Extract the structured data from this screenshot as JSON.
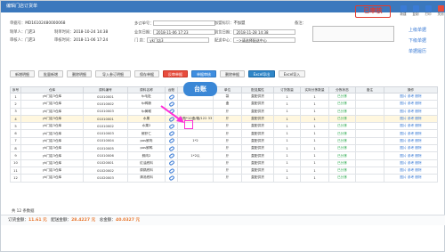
{
  "window": {
    "title": "编辑门店订货单"
  },
  "status_stamp": "已审核",
  "top_icons": [
    {
      "icon": "add-icon",
      "label": "新建",
      "color": "#3a7bd5"
    },
    {
      "icon": "copy-icon",
      "label": "复制",
      "color": "#3a7bd5"
    },
    {
      "icon": "print-icon",
      "label": "打印",
      "color": "#3a7bd5"
    },
    {
      "icon": "close-icon",
      "label": "关闭",
      "color": "#e84c3d"
    }
  ],
  "side_links": [
    "上级单据",
    "下级单据",
    "单据履历"
  ],
  "form": {
    "row1": [
      {
        "label": "单据号：",
        "value": "MD16102480000068"
      },
      {
        "label": "多订单号：",
        "value": ""
      },
      {
        "label": "加盟标识：",
        "value": "不加盟"
      },
      {
        "label": "备注：",
        "value": ""
      }
    ],
    "row2": [
      {
        "label": "制单人：",
        "value": "门店3"
      },
      {
        "label": "制单时间：",
        "value": "2018-10-24 14:38"
      },
      {
        "label": "业务日期：",
        "value": "2018-11-06 17:23"
      },
      {
        "label": "到货日期：",
        "value": "2018-11-28 14:38"
      }
    ],
    "row3": [
      {
        "label": "审核人：",
        "value": "门店3"
      },
      {
        "label": "审核时间：",
        "value": "2018-11-06 17:24"
      },
      {
        "label": "门  店：",
        "value": "yk门店3"
      },
      {
        "label": "配送中心：",
        "value": "-->请选择配送中心"
      }
    ]
  },
  "toolbar": [
    {
      "label": "新增明细",
      "style": "normal"
    },
    {
      "label": "批量新增",
      "style": "normal"
    },
    {
      "label": "删除明细",
      "style": "normal"
    },
    {
      "label": "导入参订明细",
      "style": "normal"
    },
    {
      "label": "保存单据",
      "style": "normal"
    },
    {
      "label": "反审单据",
      "style": "red"
    },
    {
      "label": "单据审核",
      "style": "sel"
    },
    {
      "label": "删除单据",
      "style": "normal"
    },
    {
      "label": "Excel导出",
      "style": "blue"
    },
    {
      "label": "Excel导入",
      "style": "normal"
    }
  ],
  "callout": "台账",
  "grid": {
    "columns": [
      "序号",
      "仓库",
      "原料编号",
      "原料名称",
      "台账",
      "规格",
      "单位",
      "配送属性",
      "订货数量",
      "实际分拣数量",
      "分拣状态",
      "备注",
      "操作"
    ],
    "rows": [
      [
        "1",
        "yk门店3仓库",
        "01010001",
        "fp毛肚",
        "",
        "",
        "袋",
        "直配供货",
        "1",
        "1",
        "已分拣",
        "",
        "图片 参考 删除"
      ],
      [
        "2",
        "yk门店3仓库",
        "01010002",
        "fp鸭肠",
        "",
        "",
        "盒",
        "直配供货",
        "1",
        "1",
        "已分拣",
        "",
        "图片 参考 删除"
      ],
      [
        "3",
        "yk门店3仓库",
        "01010003",
        "fp黄喉",
        "",
        "",
        "斤",
        "直配供货",
        "1",
        "1",
        "已分拣",
        "",
        "图片 参考 删除"
      ],
      [
        "4",
        "yk门店3仓库",
        "01010001",
        "水果",
        "",
        "10瓶*10盒/箱/122 33",
        "斤",
        "直配供货",
        "1",
        "1",
        "已分拣",
        "",
        "图片 参考 删除"
      ],
      [
        "5",
        "yk门店3仓库",
        "01010002",
        "水果2",
        "",
        "",
        "斤",
        "直配供货",
        "1",
        "1",
        "已分拣",
        "",
        "图片 参考 删除"
      ],
      [
        "6",
        "yk门店3仓库",
        "01010003",
        "鲜虾仁",
        "",
        "",
        "斤",
        "直配供货",
        "1",
        "1",
        "已分拣",
        "",
        "图片 参考 删除"
      ],
      [
        "7",
        "yk门店3仓库",
        "01010004",
        "pos鲜肉",
        "",
        "1*2",
        "斤",
        "直配供货",
        "1",
        "1",
        "已分拣",
        "",
        "图片 参考 删除"
      ],
      [
        "8",
        "yk门店3仓库",
        "01010005",
        "pos鲜鸭",
        "",
        "",
        "斤",
        "直配供货",
        "1",
        "1",
        "已分拣",
        "",
        "图片 参考 删除"
      ],
      [
        "9",
        "yk门店3仓库",
        "01010006",
        "鲜肉2",
        "",
        "1*2以",
        "斤",
        "直配供货",
        "1",
        "1",
        "已分拣",
        "",
        "图片 参考 删除"
      ],
      [
        "10",
        "yk门店3仓库",
        "01020001",
        "红油底料",
        "",
        "",
        "斤",
        "直配供货",
        "1",
        "1",
        "已分拣",
        "",
        "图片 参考 删除"
      ],
      [
        "11",
        "yk门店3仓库",
        "01020002",
        "原锅底料",
        "",
        "",
        "斤",
        "直配供货",
        "1",
        "1",
        "已分拣",
        "",
        "图片 参考 删除"
      ],
      [
        "12",
        "yk门店3仓库",
        "01020003",
        "清汤底料",
        "",
        "",
        "斤",
        "直配供货",
        "1",
        "1",
        "已分拣",
        "",
        "图片 参考 删除"
      ]
    ]
  },
  "count_text": "共 12 条数据",
  "footer": {
    "order_label": "订货金额：",
    "order_value": "11.61 元",
    "delivery_label": "配送金额：",
    "delivery_value": "28.4227 元",
    "total_label": "总金额：",
    "total_value": "40.0327 元"
  }
}
